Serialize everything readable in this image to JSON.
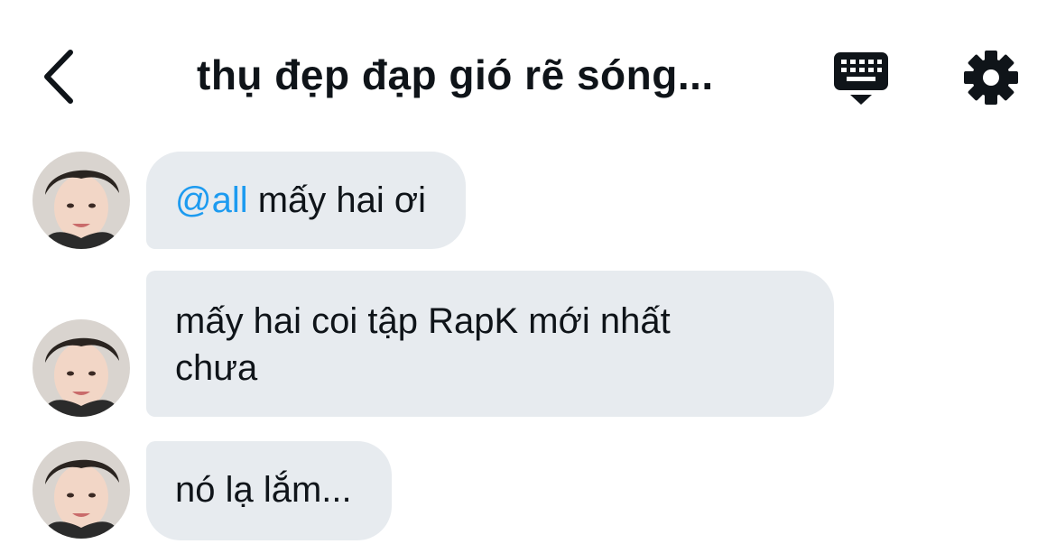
{
  "header": {
    "title": "thụ đẹp đạp gió rẽ sóng..."
  },
  "icons": {
    "back": "chevron-left-icon",
    "keyboard": "keyboard-icon",
    "settings": "gear-icon"
  },
  "messages": [
    {
      "mention": "@all",
      "text": " mấy hai ơi"
    },
    {
      "line1": "mấy hai coi tập RapK mới nhất",
      "line2": "chưa"
    },
    {
      "text": "nó lạ lắm..."
    }
  ],
  "colors": {
    "bubble": "#e7ebef",
    "mention": "#1d9bf0",
    "text": "#0f1419"
  }
}
